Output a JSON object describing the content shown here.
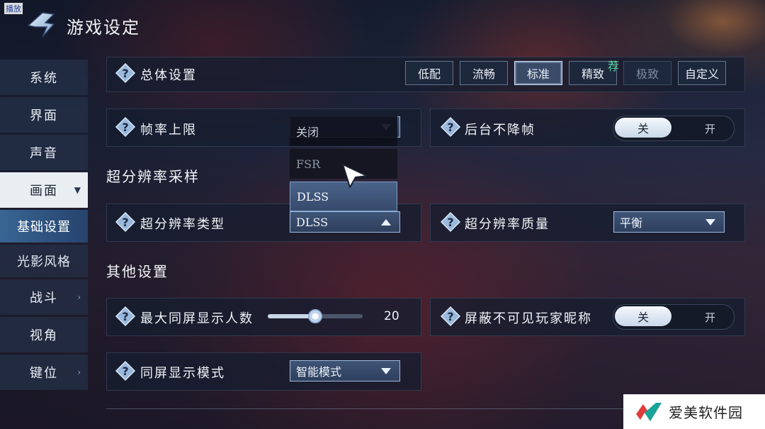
{
  "corner_label": "播放",
  "header": {
    "title": "游戏设定",
    "logo_icon": "chevron-emblem-icon"
  },
  "sidebar": {
    "items": [
      {
        "label": "系统"
      },
      {
        "label": "界面"
      },
      {
        "label": "声音"
      },
      {
        "label": "画面",
        "expanded": true
      }
    ],
    "subitems": [
      {
        "label": "基础设置",
        "active": true
      },
      {
        "label": "光影风格"
      }
    ],
    "more_items": [
      {
        "label": "战斗"
      },
      {
        "label": "视角"
      },
      {
        "label": "键位"
      }
    ]
  },
  "overall": {
    "label": "总体设置",
    "presets": [
      "低配",
      "流畅",
      "标准",
      "精致",
      "极致",
      "自定义"
    ],
    "selected": "标准",
    "recommend_badge": "荐",
    "disabled": "极致"
  },
  "frame_rate": {
    "label": "帧率上限"
  },
  "background_frames": {
    "label": "后台不降帧",
    "on_label": "关",
    "off_label": "开"
  },
  "upscaling_section": {
    "title": "超分辨率采样"
  },
  "upscale_type": {
    "label": "超分辨率类型",
    "value": "DLSS",
    "options": [
      "关闭",
      "FSR",
      "DLSS"
    ]
  },
  "upscale_quality": {
    "label": "超分辨率质量",
    "value": "平衡"
  },
  "other_section": {
    "title": "其他设置"
  },
  "max_players": {
    "label": "最大同屏显示人数",
    "value": "20",
    "fill_fraction": 0.5
  },
  "hide_names": {
    "label": "屏蔽不可见玩家昵称",
    "on_label": "关",
    "off_label": "开"
  },
  "display_mode": {
    "label": "同屏显示模式",
    "value": "智能模式"
  },
  "watermark": {
    "text": "爱美软件园"
  },
  "colors": {
    "accent": "#9fbbe0",
    "recommend": "#58d49a",
    "panel": "#161e30"
  }
}
